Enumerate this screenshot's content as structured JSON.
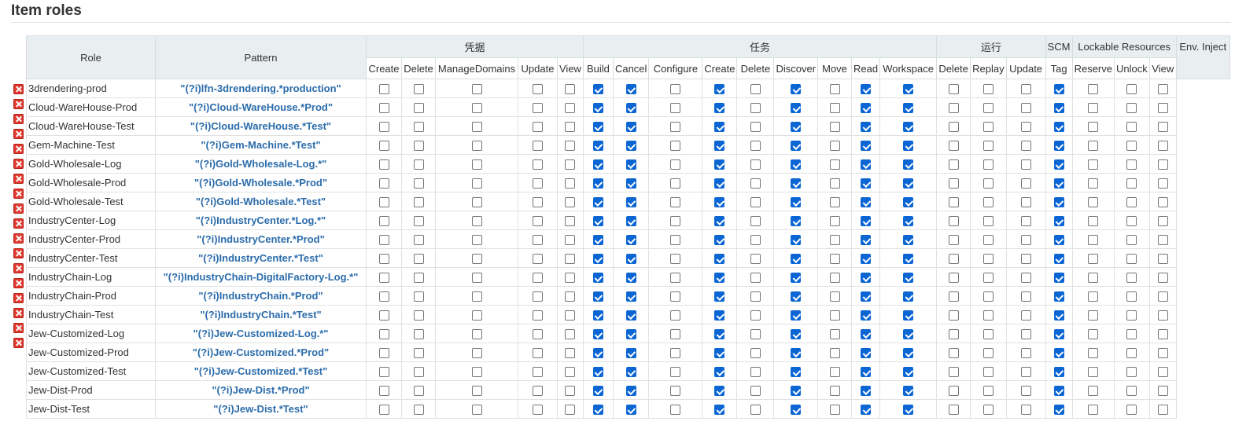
{
  "section_title": "Item roles",
  "columns": {
    "role_header": "Role",
    "pattern_header": "Pattern",
    "groups": [
      {
        "label": "凭据",
        "span": 5
      },
      {
        "label": "任务",
        "span": 9
      },
      {
        "label": "运行",
        "span": 3
      },
      {
        "label": "SCM",
        "span": 1
      },
      {
        "label": "Lockable Resources",
        "span": 3
      },
      {
        "label": "Env. Inject",
        "span": 1
      }
    ],
    "permissions": [
      "Create",
      "Delete",
      "ManageDomains",
      "Update",
      "View",
      "Build",
      "Cancel",
      "Configure",
      "Create",
      "Delete",
      "Discover",
      "Move",
      "Read",
      "Workspace",
      "Delete",
      "Replay",
      "Update",
      "Tag",
      "Reserve",
      "Unlock",
      "View"
    ]
  },
  "rows": [
    {
      "role": "3drendering-prod",
      "pattern": "\"(?i)lfn-3drendering.*production\""
    },
    {
      "role": "Cloud-WareHouse-Prod",
      "pattern": "\"(?i)Cloud-WareHouse.*Prod\""
    },
    {
      "role": "Cloud-WareHouse-Test",
      "pattern": "\"(?i)Cloud-WareHouse.*Test\""
    },
    {
      "role": "Gem-Machine-Test",
      "pattern": "\"(?i)Gem-Machine.*Test\""
    },
    {
      "role": "Gold-Wholesale-Log",
      "pattern": "\"(?i)Gold-Wholesale-Log.*\""
    },
    {
      "role": "Gold-Wholesale-Prod",
      "pattern": "\"(?i)Gold-Wholesale.*Prod\""
    },
    {
      "role": "Gold-Wholesale-Test",
      "pattern": "\"(?i)Gold-Wholesale.*Test\""
    },
    {
      "role": "IndustryCenter-Log",
      "pattern": "\"(?i)IndustryCenter.*Log.*\""
    },
    {
      "role": "IndustryCenter-Prod",
      "pattern": "\"(?i)IndustryCenter.*Prod\""
    },
    {
      "role": "IndustryCenter-Test",
      "pattern": "\"(?i)IndustryCenter.*Test\""
    },
    {
      "role": "IndustryChain-Log",
      "pattern": "\"(?i)IndustryChain-DigitalFactory-Log.*\""
    },
    {
      "role": "IndustryChain-Prod",
      "pattern": "\"(?i)IndustryChain.*Prod\""
    },
    {
      "role": "IndustryChain-Test",
      "pattern": "\"(?i)IndustryChain.*Test\""
    },
    {
      "role": "Jew-Customized-Log",
      "pattern": "\"(?i)Jew-Customized-Log.*\""
    },
    {
      "role": "Jew-Customized-Prod",
      "pattern": "\"(?i)Jew-Customized.*Prod\""
    },
    {
      "role": "Jew-Customized-Test",
      "pattern": "\"(?i)Jew-Customized.*Test\""
    },
    {
      "role": "Jew-Dist-Prod",
      "pattern": "\"(?i)Jew-Dist.*Prod\""
    },
    {
      "role": "Jew-Dist-Test",
      "pattern": "\"(?i)Jew-Dist.*Test\""
    }
  ],
  "checked_pattern": [
    false,
    false,
    false,
    false,
    false,
    true,
    true,
    false,
    true,
    false,
    true,
    false,
    true,
    true,
    false,
    false,
    false,
    true,
    false,
    false,
    false
  ],
  "icons": {
    "delete": "delete-icon",
    "checkbox": "checkbox-icon"
  },
  "colors": {
    "header_bg": "#e9eef0",
    "pattern_text": "#2b6cab",
    "checkbox_checked": "#0b66d4",
    "delete_red": "#e0392f"
  }
}
